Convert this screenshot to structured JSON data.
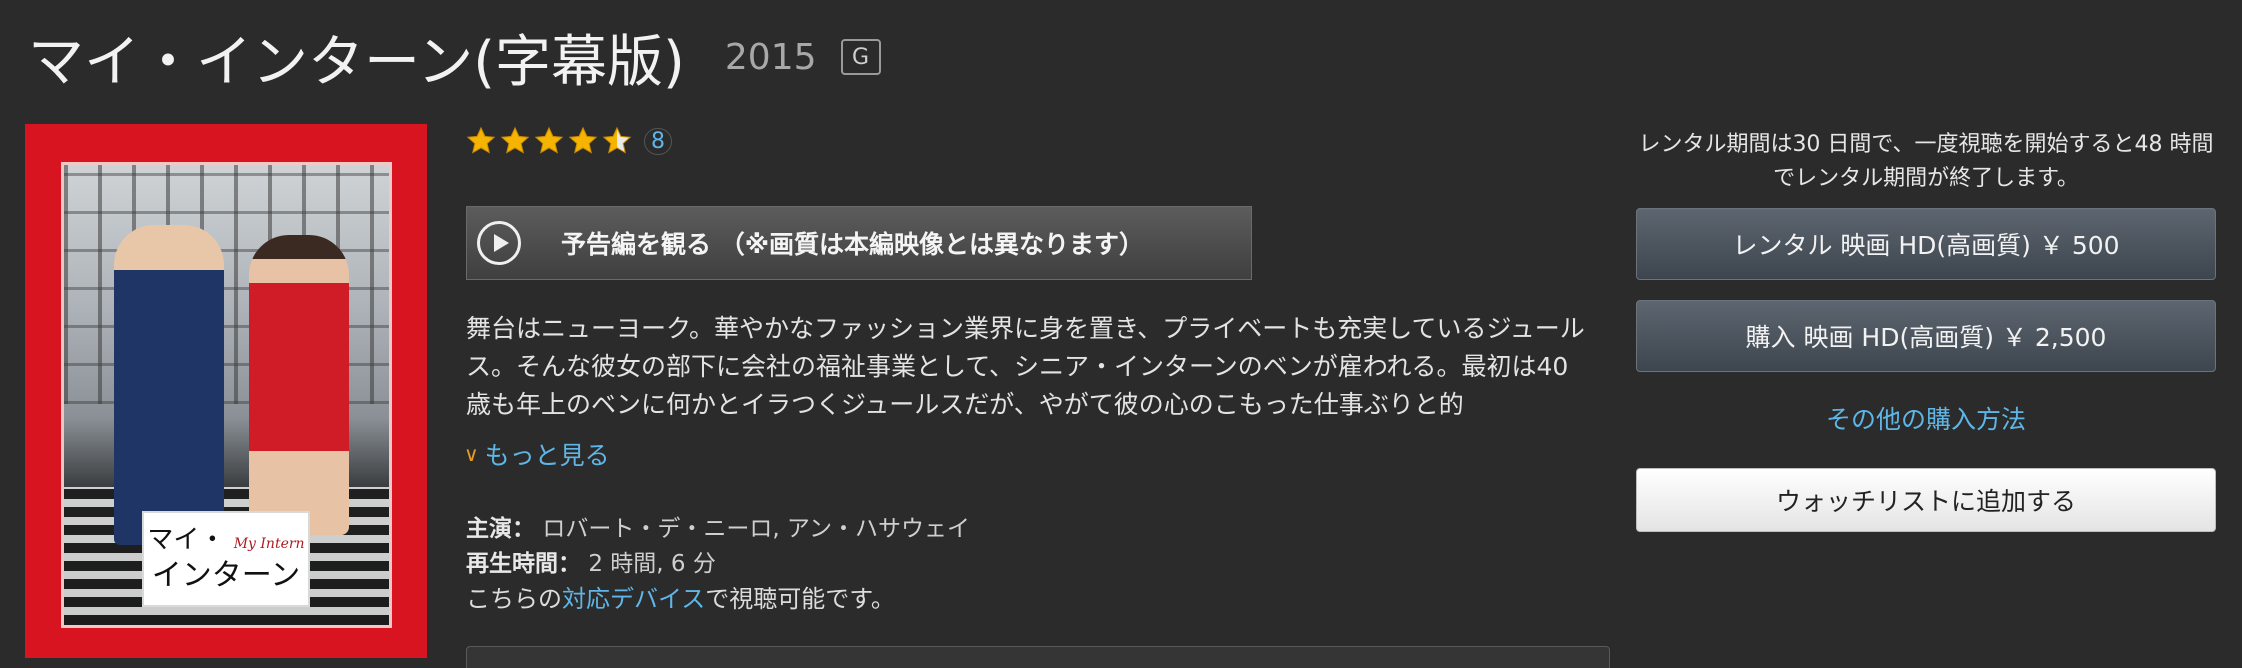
{
  "header": {
    "title": "マイ・インターン(字幕版)",
    "year": "2015",
    "rating": "G"
  },
  "poster": {
    "logo_line1": "マイ・",
    "logo_line1_en": "My Intern",
    "logo_line2": "インターン",
    "frame_color": "#d7141f"
  },
  "reviews": {
    "stars": 4.5,
    "count": "8"
  },
  "trailer": {
    "label": "予告編を観る （※画質は本編映像とは異なります）"
  },
  "synopsis": "舞台はニューヨーク。華やかなファッション業界に身を置き、プライベートも充実しているジュールス。そんな彼女の部下に会社の福祉事業として、シニア・インターンのベンが雇われる。最初は40歳も年上のベンに何かとイラつくジュールスだが、やがて彼の心のこもった仕事ぶりと的",
  "more_link": "もっと見る",
  "meta": {
    "cast_label": "主演：",
    "cast_value": "ロバート・デ・ニーロ, アン・ハサウェイ",
    "runtime_label": "再生時間：",
    "runtime_value": "2 時間, 6 分",
    "device_prefix": "こちらの",
    "device_link": "対応デバイス",
    "device_suffix": "で視聴可能です。"
  },
  "purchase": {
    "rental_note": "レンタル期間は30 日間で、一度視聴を開始すると48 時間でレンタル期間が終了します。",
    "rent_button": "レンタル 映画 HD(高画質) ￥ 500",
    "buy_button": "購入 映画 HD(高画質) ￥ 2,500",
    "other_methods": "その他の購入方法",
    "watchlist_button": "ウォッチリストに追加する"
  },
  "colors": {
    "background": "#2b2b2b",
    "link": "#5fb6e6",
    "star": "#f5b400",
    "accent_chevron": "#e79a25"
  }
}
